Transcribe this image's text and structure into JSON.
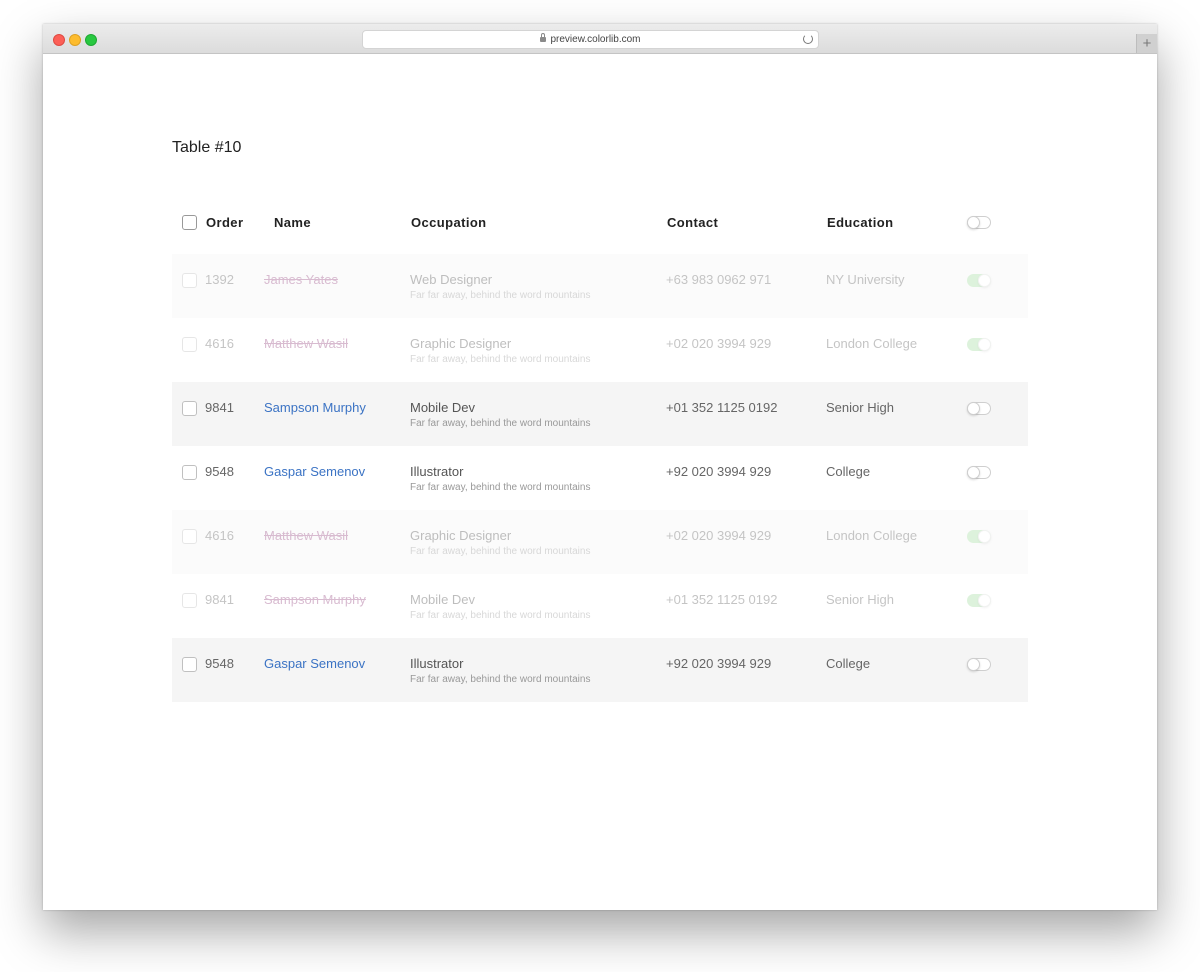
{
  "browser": {
    "url": "preview.colorlib.com",
    "new_tab_symbol": "+"
  },
  "page": {
    "title": "Table #10"
  },
  "table": {
    "columns": [
      "Order",
      "Name",
      "Occupation",
      "Contact",
      "Education"
    ],
    "rows": [
      {
        "order": "1392",
        "name": "James Yates",
        "occupation": "Web Designer",
        "description": "Far far away, behind the word mountains",
        "contact": "+63 983 0962 971",
        "education": "NY University",
        "active": true
      },
      {
        "order": "4616",
        "name": "Matthew Wasil",
        "occupation": "Graphic Designer",
        "description": "Far far away, behind the word mountains",
        "contact": "+02 020 3994 929",
        "education": "London College",
        "active": true
      },
      {
        "order": "9841",
        "name": "Sampson Murphy",
        "occupation": "Mobile Dev",
        "description": "Far far away, behind the word mountains",
        "contact": "+01 352 1125 0192",
        "education": "Senior High",
        "active": false
      },
      {
        "order": "9548",
        "name": "Gaspar Semenov",
        "occupation": "Illustrator",
        "description": "Far far away, behind the word mountains",
        "contact": "+92 020 3994 929",
        "education": "College",
        "active": false
      },
      {
        "order": "4616",
        "name": "Matthew Wasil",
        "occupation": "Graphic Designer",
        "description": "Far far away, behind the word mountains",
        "contact": "+02 020 3994 929",
        "education": "London College",
        "active": true
      },
      {
        "order": "9841",
        "name": "Sampson Murphy",
        "occupation": "Mobile Dev",
        "description": "Far far away, behind the word mountains",
        "contact": "+01 352 1125 0192",
        "education": "Senior High",
        "active": true
      },
      {
        "order": "9548",
        "name": "Gaspar Semenov",
        "occupation": "Illustrator",
        "description": "Far far away, behind the word mountains",
        "contact": "+92 020 3994 929",
        "education": "College",
        "active": false
      }
    ]
  },
  "colors": {
    "link": "#3b73c4",
    "toggle_on": "#a8dfa6",
    "row_shade": "#f5f5f5"
  }
}
